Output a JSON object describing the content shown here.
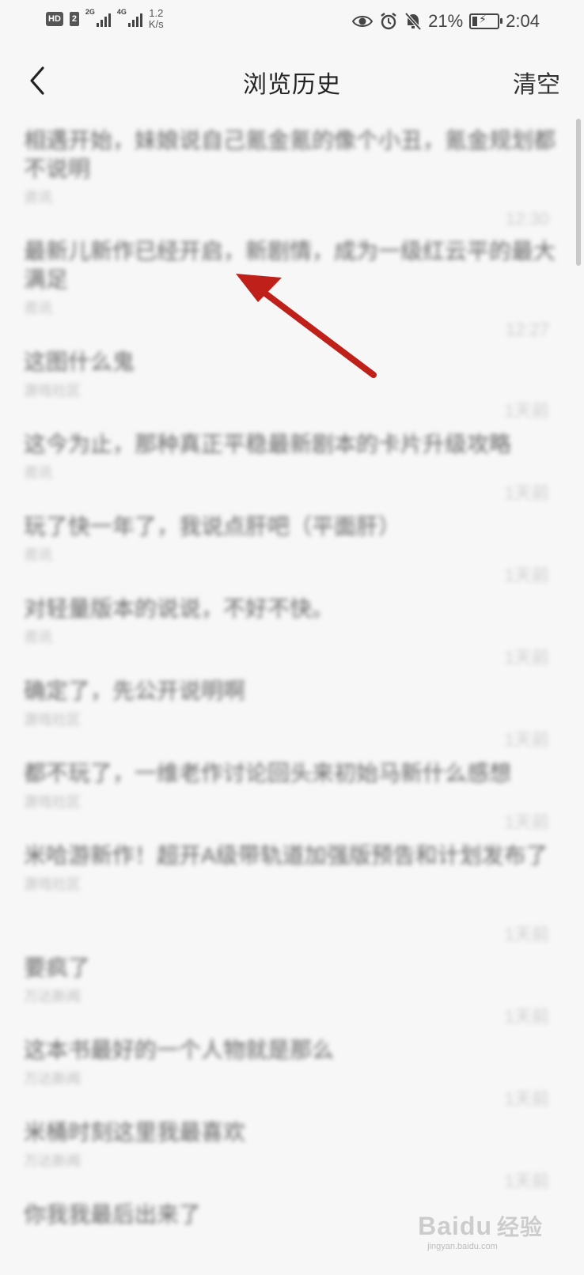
{
  "status_bar": {
    "hd_label": "HD",
    "sim_label": "2",
    "net1": "2G",
    "net2": "4G",
    "speed_value": "1.2",
    "speed_unit": "K/s",
    "battery_percent": "21%",
    "time": "2:04",
    "icons": [
      "eye-icon",
      "alarm-icon",
      "mute-icon",
      "battery-icon"
    ]
  },
  "header": {
    "back_icon": "chevron-left-icon",
    "title": "浏览历史",
    "clear_label": "清空"
  },
  "history": [
    {
      "title": "相遇开始，妹娘说自己氪金氪的像个小丑，氪金规划都不说明",
      "sub": "资讯",
      "time": "12:30"
    },
    {
      "title": "最新儿新作已经开启，新剧情，成为一级红云平的最大满足",
      "sub": "资讯",
      "time": "12:27"
    },
    {
      "title": "这图什么鬼",
      "sub": "游戏社区",
      "time": "1天前"
    },
    {
      "title": "这今为止，那种真正平稳最新剧本的卡片升级攻略",
      "sub": "资讯",
      "time": "1天前"
    },
    {
      "title": "玩了快一年了，我说点肝吧（平面肝）",
      "sub": "资讯",
      "time": "1天前"
    },
    {
      "title": "对轻量版本的说说，不好不快。",
      "sub": "资讯",
      "time": "1天前"
    },
    {
      "title": "确定了，先公开说明啊",
      "sub": "游戏社区",
      "time": "1天前"
    },
    {
      "title": "都不玩了，一维老作讨论回头来初始马新什么感想",
      "sub": "游戏社区",
      "time": "1天前"
    },
    {
      "title": "米哈游新作！超开A级带轨道加强版预告和计划发布了",
      "sub": "游戏社区",
      "time": "1天前"
    },
    {
      "title": "要疯了",
      "sub": "万达新闻",
      "time": "1天前"
    },
    {
      "title": "这本书最好的一个人物就是那么",
      "sub": "万达新闻",
      "time": "1天前"
    },
    {
      "title": "米桶时刻这里我最喜欢",
      "sub": "万达新闻",
      "time": "1天前"
    },
    {
      "title": "你我我最后出来了",
      "sub": "",
      "time": ""
    }
  ],
  "watermark": {
    "logo": "Bai",
    "logo_tail": "du",
    "logo_cn": "经验",
    "url": "jingyan.baidu.com"
  },
  "colors": {
    "background": "#f7f7f7",
    "arrow": "#c0201a",
    "text_primary": "#222222"
  }
}
